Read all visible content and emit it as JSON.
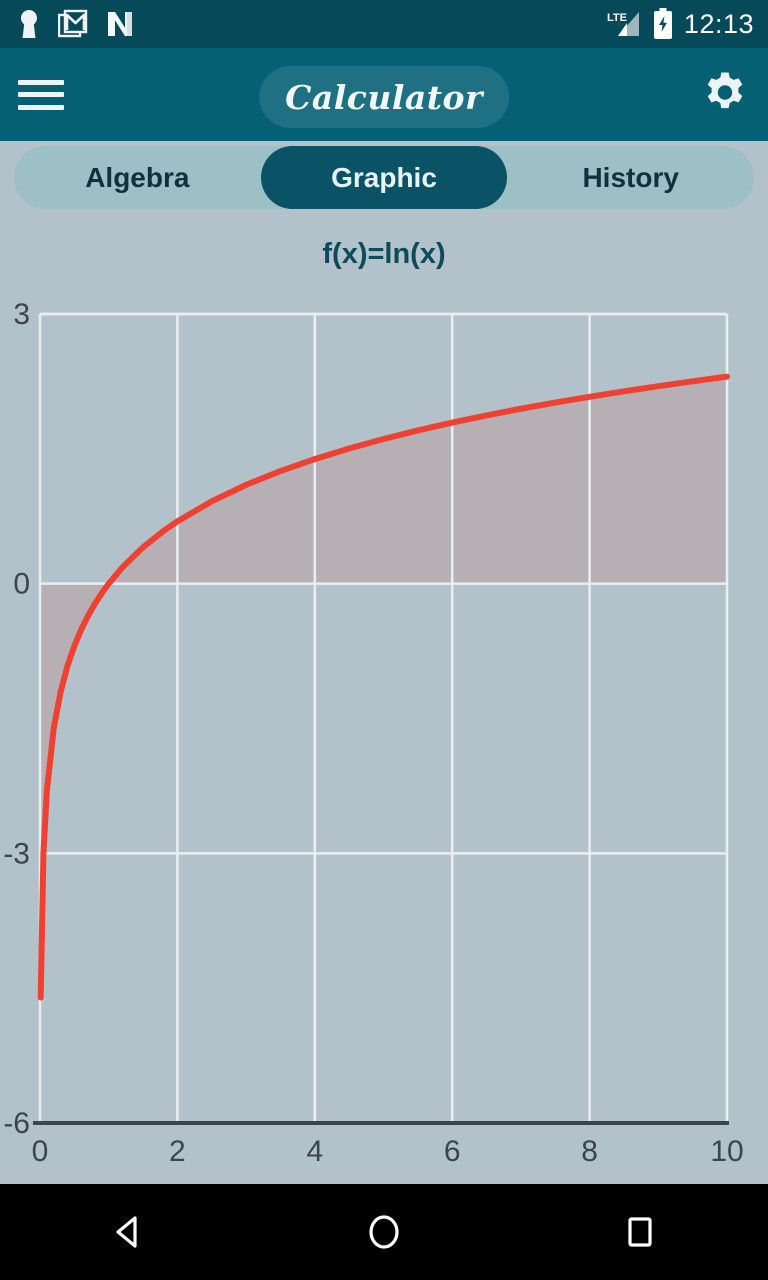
{
  "status_bar": {
    "icons": [
      "keyhole-icon",
      "gmail-icon",
      "netflix-n-icon"
    ],
    "network_label": "LTE",
    "signal_icon": "signal-bars-icon",
    "battery_icon": "battery-charging-icon",
    "time": "12:13"
  },
  "app_bar": {
    "menu_icon": "hamburger-menu-icon",
    "title": "Calculator",
    "settings_icon": "gear-icon"
  },
  "tabs": [
    {
      "label": "Algebra",
      "active": false
    },
    {
      "label": "Graphic",
      "active": true
    },
    {
      "label": "History",
      "active": false
    }
  ],
  "nav_bar": {
    "back": "back-triangle-icon",
    "home": "home-circle-icon",
    "recents": "recents-square-icon"
  },
  "colors": {
    "status_bar": "#064a59",
    "app_bar": "#056074",
    "tab_inactive_bg": "#9dc0c7",
    "tab_active_bg": "#0a5265",
    "chart_bg": "#b3c2ca",
    "curve": "#ef4132",
    "fill": "#b6b0b4",
    "grid": "#e9eef0",
    "axis": "#3d4450",
    "title_text": "#0d4b5c",
    "tick_text": "#3b4450"
  },
  "chart_data": {
    "type": "line",
    "title": "f(x)=ln(x)",
    "xlabel": "",
    "ylabel": "",
    "xlim": [
      0,
      10
    ],
    "ylim": [
      -6,
      3
    ],
    "xticks": [
      0,
      2,
      4,
      6,
      8,
      10
    ],
    "xtick_labels": [
      "0",
      "2",
      "4",
      "6",
      "8",
      "10"
    ],
    "yticks": [
      3,
      0,
      -3,
      -6
    ],
    "ytick_labels": [
      "3",
      "0",
      "-3",
      "-6"
    ],
    "grid": true,
    "legend": "none",
    "fill_to_y": 0,
    "series": [
      {
        "name": "ln(x)",
        "color": "#ef4132",
        "x": [
          0.01,
          0.05,
          0.1,
          0.2,
          0.3,
          0.4,
          0.5,
          0.6,
          0.7,
          0.8,
          0.9,
          1.0,
          1.2,
          1.5,
          1.8,
          2.0,
          2.5,
          3.0,
          3.5,
          4.0,
          4.5,
          5.0,
          5.5,
          6.0,
          6.5,
          7.0,
          7.5,
          8.0,
          8.5,
          9.0,
          9.5,
          10.0
        ],
        "y": [
          -4.605,
          -3.0,
          -2.303,
          -1.609,
          -1.204,
          -0.916,
          -0.693,
          -0.511,
          -0.357,
          -0.223,
          -0.105,
          0.0,
          0.182,
          0.405,
          0.588,
          0.693,
          0.916,
          1.099,
          1.253,
          1.386,
          1.504,
          1.609,
          1.705,
          1.792,
          1.872,
          1.946,
          2.015,
          2.079,
          2.14,
          2.197,
          2.251,
          2.303
        ]
      }
    ]
  }
}
